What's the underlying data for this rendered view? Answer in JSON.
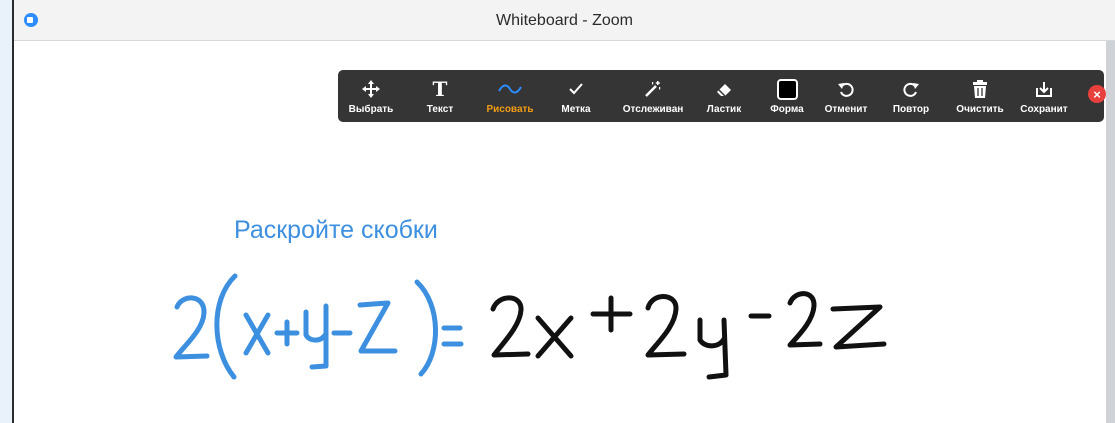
{
  "window": {
    "title": "Whiteboard - Zoom"
  },
  "toolbar": {
    "tools": [
      {
        "label": "Выбрать",
        "icon": "move-icon"
      },
      {
        "label": "Текст",
        "icon": "text-icon"
      },
      {
        "label": "Рисовать",
        "icon": "draw-icon",
        "active": true
      },
      {
        "label": "Метка",
        "icon": "stamp-icon"
      },
      {
        "label": "Отслеживан",
        "icon": "spotlight-icon"
      },
      {
        "label": "Ластик",
        "icon": "eraser-icon"
      },
      {
        "label": "Форма",
        "icon": "format-icon"
      },
      {
        "label": "Отменит",
        "icon": "undo-icon"
      },
      {
        "label": "Повтор",
        "icon": "redo-icon"
      },
      {
        "label": "Очистить",
        "icon": "trash-icon"
      },
      {
        "label": "Сохранит",
        "icon": "save-icon"
      }
    ],
    "close_icon": "close-icon",
    "active_color": "#f39c12"
  },
  "canvas": {
    "heading": "Раскройте скобки",
    "heading_color": "#3d8fe0",
    "blue_expression": "2(x+y-z)=",
    "black_expression": "2x+2y-2z",
    "blue_ink": "#3d8fe0",
    "black_ink": "#111111"
  }
}
